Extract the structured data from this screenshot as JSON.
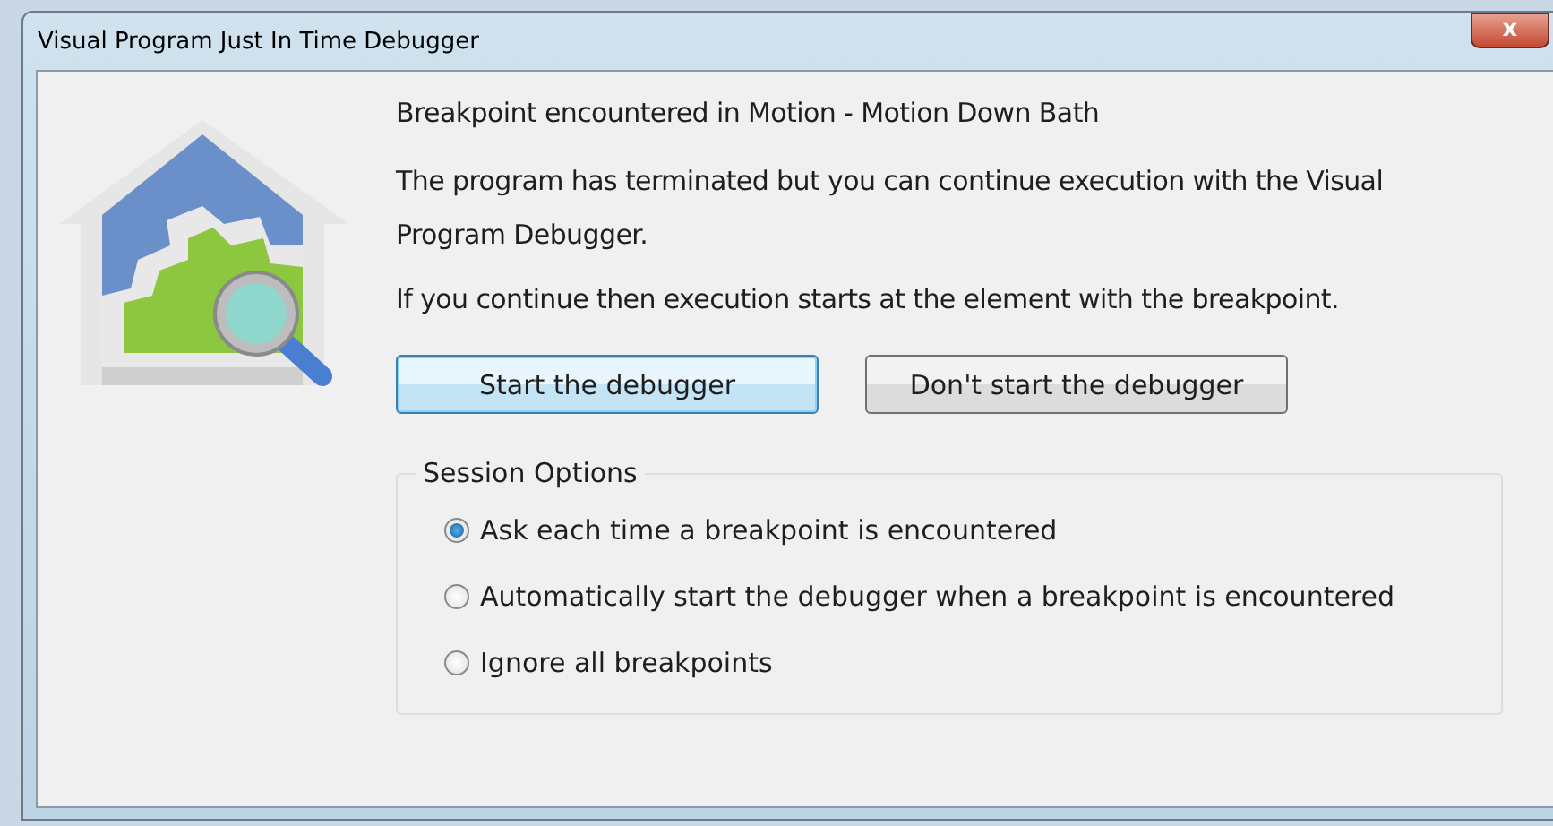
{
  "window": {
    "title": "Visual Program Just In Time Debugger",
    "close_glyph": "x"
  },
  "heading": "Breakpoint encountered in Motion - Motion Down Bath",
  "message": "The program has terminated but you can continue execution with the Visual Program Debugger.",
  "note": "If you continue then execution starts at the element with the breakpoint.",
  "buttons": [
    {
      "label": "Start the debugger",
      "default": true
    },
    {
      "label": "Don't start the debugger",
      "default": false
    }
  ],
  "session_options": {
    "title": "Session Options",
    "options": [
      {
        "label": "Ask each time a breakpoint is encountered",
        "selected": true
      },
      {
        "label": "Automatically start the debugger when a breakpoint is encountered",
        "selected": false
      },
      {
        "label": "Ignore all breakpoints",
        "selected": false
      }
    ]
  }
}
